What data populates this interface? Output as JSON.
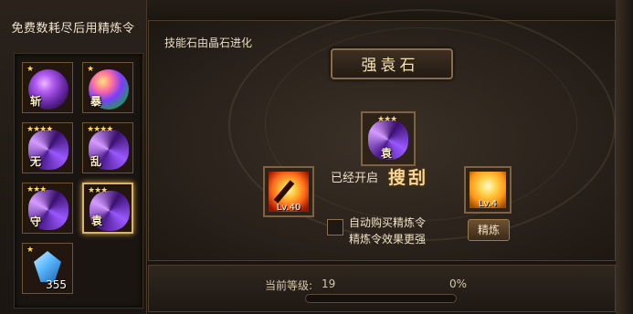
{
  "left_panel": {
    "title": "免费数耗尽后用精炼令",
    "slots": [
      {
        "stars": "★",
        "glyph": "斩",
        "style": "purple",
        "selected": false
      },
      {
        "stars": "★",
        "glyph": "暴",
        "style": "multi",
        "selected": false
      },
      {
        "stars": "★★★★",
        "glyph": "无",
        "style": "swirl",
        "selected": false
      },
      {
        "stars": "★★★★",
        "glyph": "乱",
        "style": "swirl",
        "selected": false
      },
      {
        "stars": "★★★",
        "glyph": "守",
        "style": "swirl",
        "selected": false
      },
      {
        "stars": "★★★",
        "glyph": "袁",
        "style": "swirl",
        "selected": true
      }
    ],
    "crystal": {
      "stars": "★",
      "count": "355",
      "icon": "blue-crystal-icon"
    }
  },
  "main": {
    "hint": "技能石由晶石进化",
    "title": "强袁石",
    "center_slot": {
      "stars": "★★★",
      "glyph": "袁"
    },
    "left_item": {
      "level": "Lv.40",
      "icon": "flaming-sword-icon"
    },
    "right_item": {
      "level": "Lv.4",
      "icon": "golden-flame-icon"
    },
    "opened_label": "已经开启",
    "skill_name": "搜刮",
    "auto_buy_line1": "自动购买精炼令",
    "auto_buy_line2": "精炼令效果更强",
    "auto_buy_checked": false,
    "refine_button": "精炼"
  },
  "bottom": {
    "level_label": "当前等级:",
    "level_value": "19",
    "percent_text": "0%",
    "progress": 0
  }
}
